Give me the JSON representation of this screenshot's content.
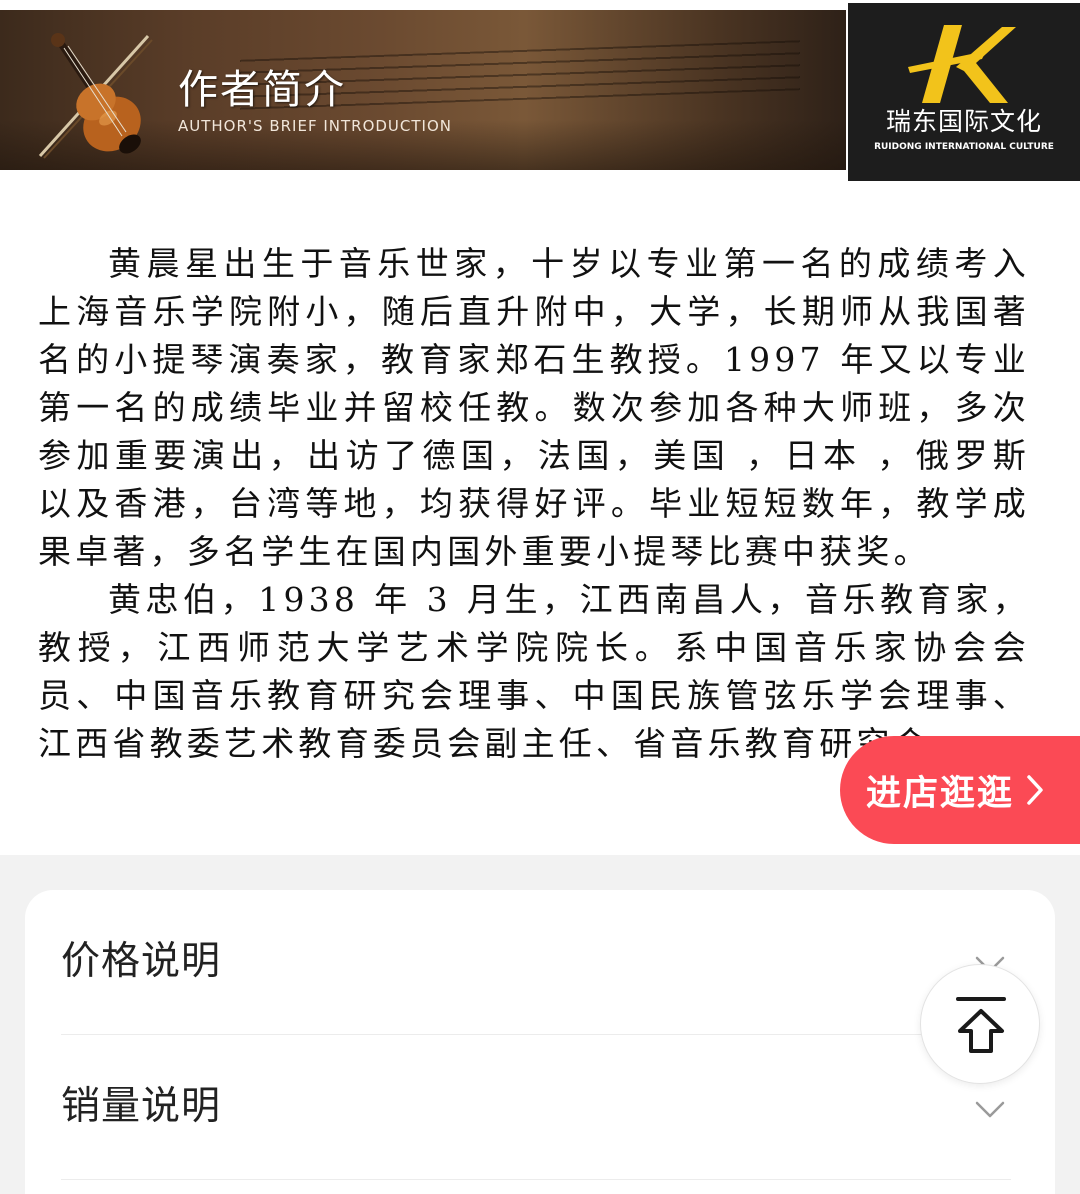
{
  "banner": {
    "title": "作者简介",
    "subtitle": "AUTHOR'S BRIEF INTRODUCTION"
  },
  "logo": {
    "name_cn": "瑞东国际文化",
    "name_en": "RUIDONG INTERNATIONAL CULTURE",
    "accent_color": "#f2c31b"
  },
  "intro": {
    "paragraph1": "黄晨星出生于音乐世家，十岁以专业第一名的成绩考入上海音乐学院附小，随后直升附中，大学，长期师从我国著名的小提琴演奏家，教育家郑石生教授。1997 年又以专业第一名的成绩毕业并留校任教。数次参加各种大师班，多次参加重要演出，出访了德国，法国，美国 ，日本 ，俄罗斯以及香港，台湾等地，均获得好评。毕业短短数年，教学成果卓著，多名学生在国内国外重要小提琴比赛中获奖。",
    "paragraph2": "黄忠伯，1938 年 3 月生，江西南昌人，音乐教育家，教授，江西师范大学艺术学院院长。系中国音乐家协会会员、中国音乐教育研究会理事、中国民族管弦乐学会理事、江西省教委艺术教育委员会副主任、省音乐教育研究会"
  },
  "shop_button": {
    "label": "进店逛逛",
    "color": "#fb4a55"
  },
  "info_rows": [
    {
      "label": "价格说明",
      "icon": "chevron-down-icon"
    },
    {
      "label": "销量说明",
      "icon": "chevron-down-icon"
    }
  ],
  "back_to_top": {
    "icon": "back-to-top-icon"
  }
}
